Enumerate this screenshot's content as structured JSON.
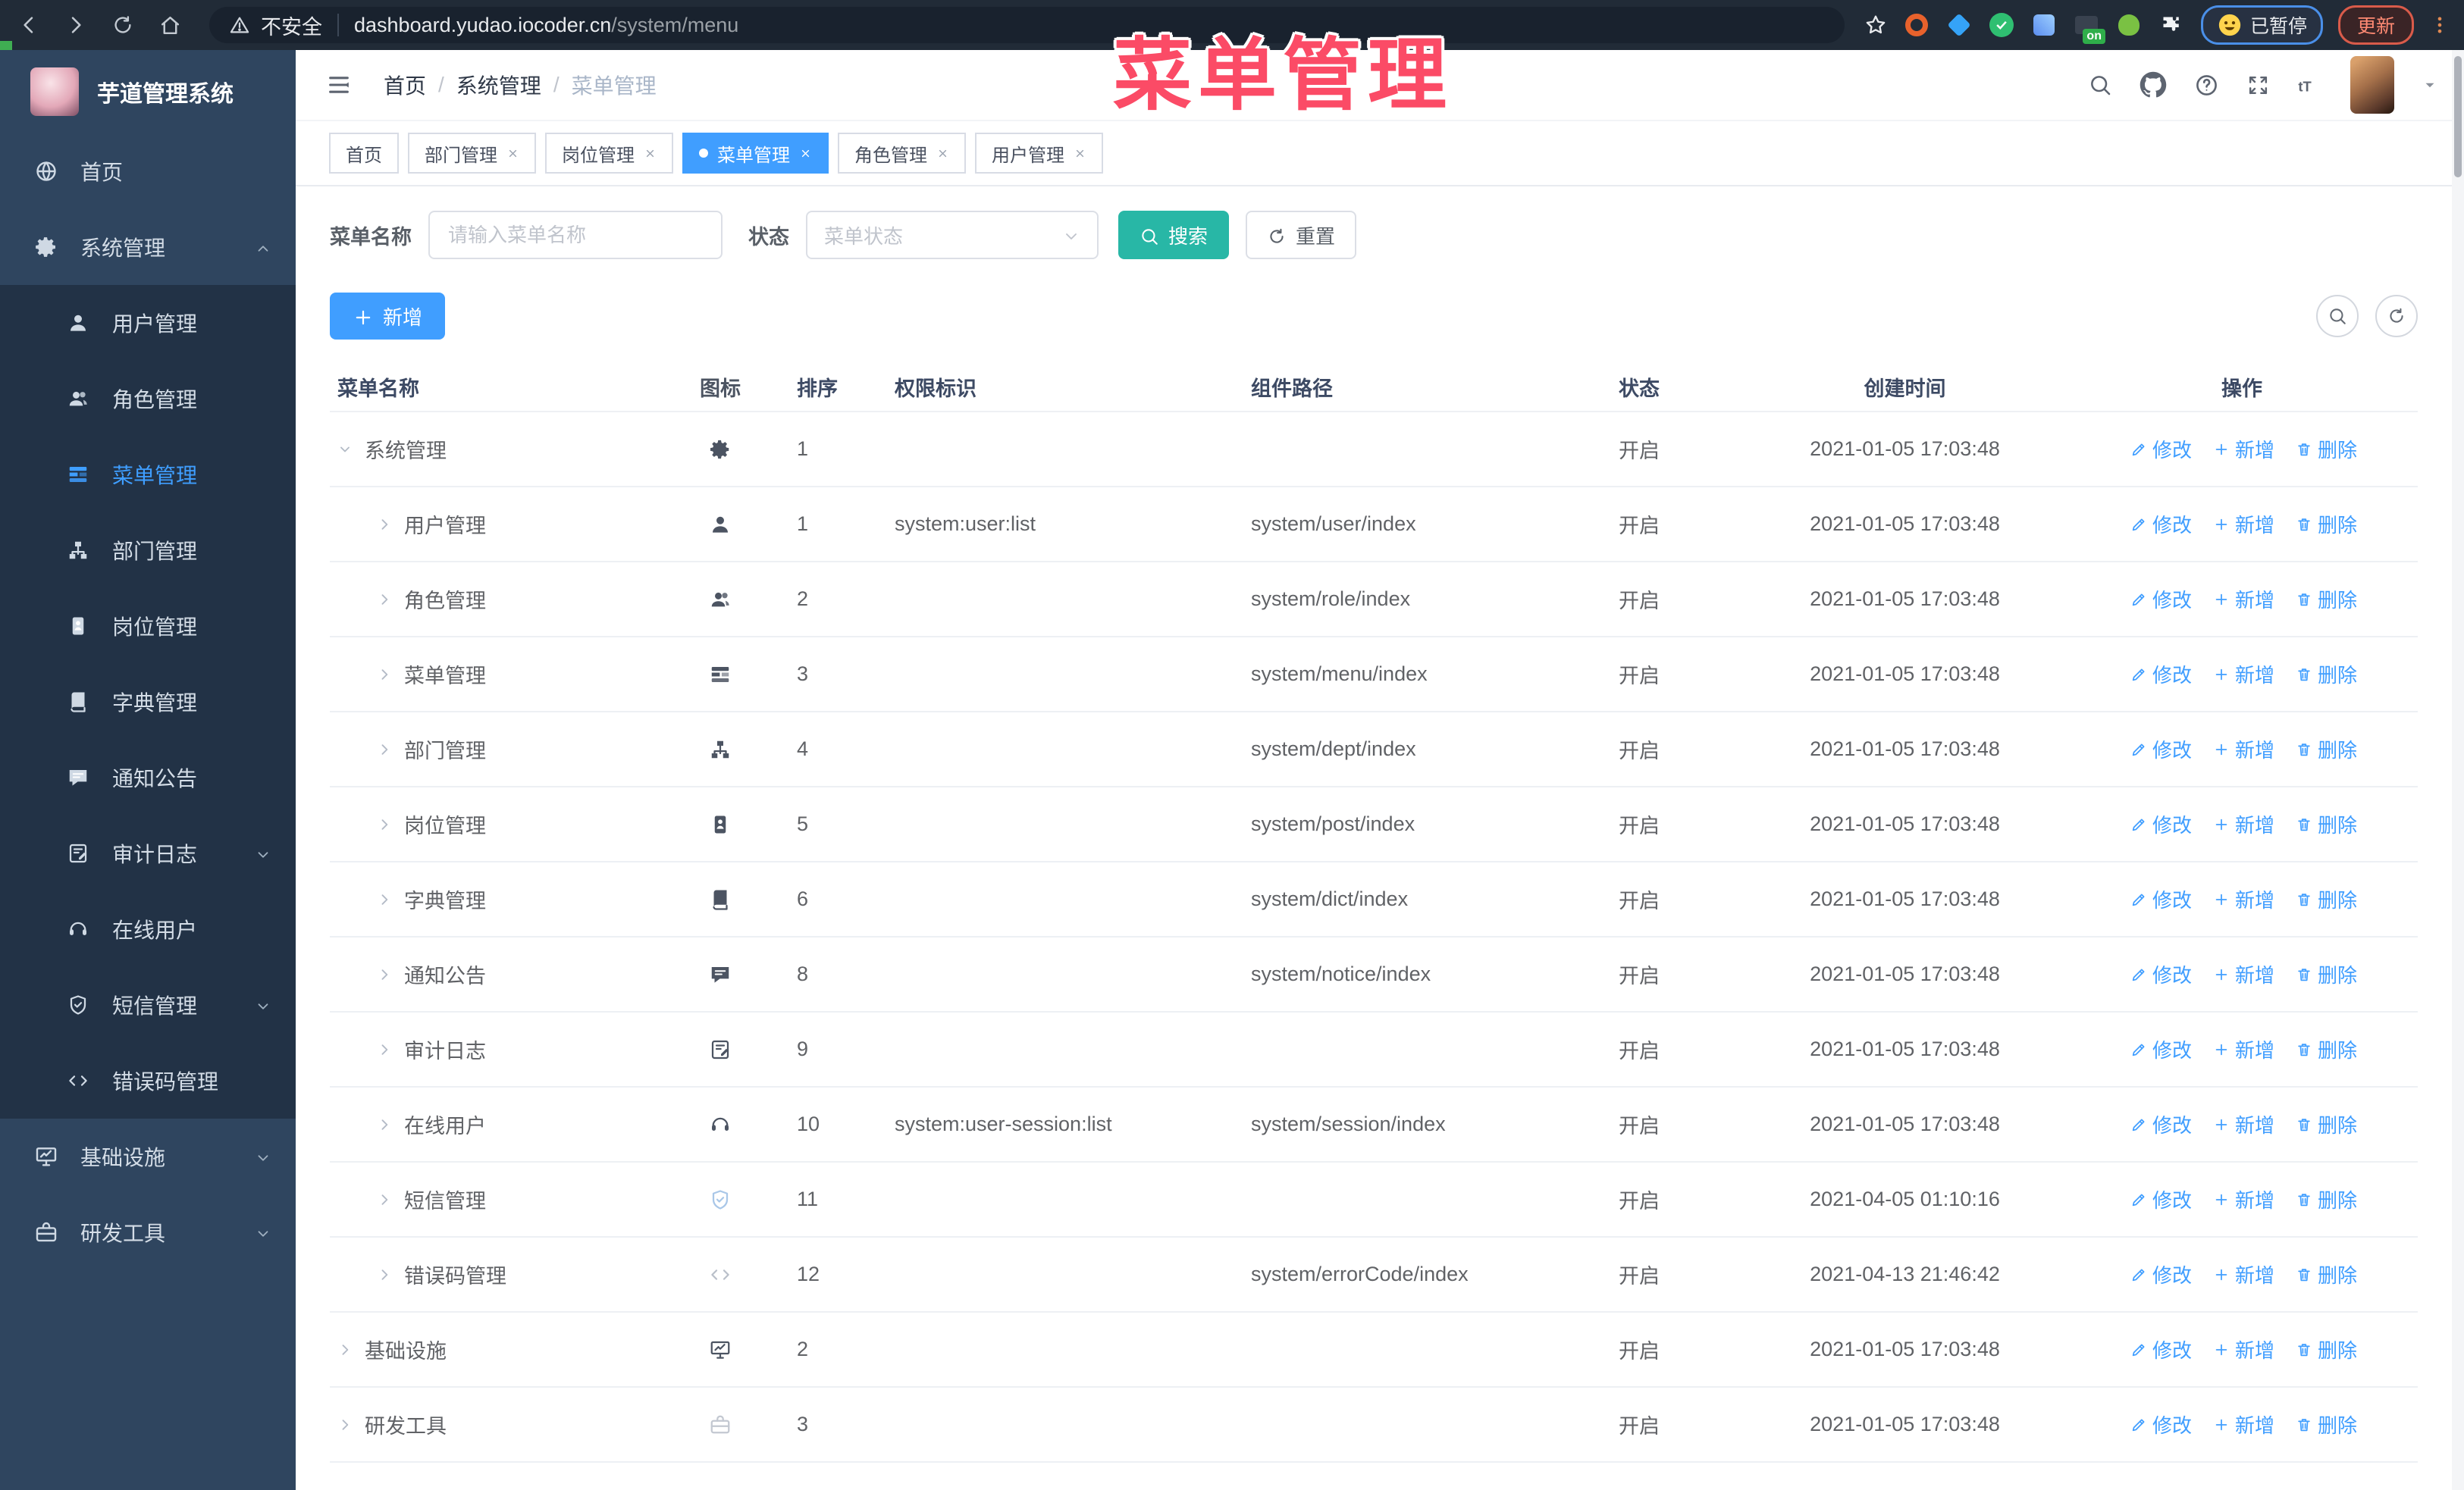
{
  "overlay": {
    "title": "菜单管理"
  },
  "browser": {
    "security_label": "不安全",
    "url_host": "dashboard.yudao.iocoder.cn",
    "url_path": "/system/menu",
    "paused_badge": "已暂停",
    "update_button": "更新",
    "extensions": [
      {
        "glyph": "ring",
        "color": "#e8622c"
      },
      {
        "glyph": "gem",
        "color": "#35a3f7"
      },
      {
        "glyph": "check",
        "color": "#2fbf71"
      },
      {
        "glyph": "grid",
        "color": "#5b8def"
      },
      {
        "glyph": "on",
        "color": "#2b3340"
      },
      {
        "glyph": "frog",
        "color": "#7ac143"
      },
      {
        "glyph": "puzzle",
        "color": "#f2f4f6"
      }
    ]
  },
  "sidebar": {
    "app_title": "芋道管理系统",
    "items": [
      {
        "label": "首页",
        "icon": "globe-icon",
        "level": 0
      },
      {
        "label": "系统管理",
        "icon": "gear-icon",
        "level": 0,
        "chevron": "up"
      },
      {
        "label": "用户管理",
        "icon": "user-icon",
        "level": 1
      },
      {
        "label": "角色管理",
        "icon": "users-icon",
        "level": 1
      },
      {
        "label": "菜单管理",
        "icon": "menu-tree-icon",
        "level": 1,
        "active": true
      },
      {
        "label": "部门管理",
        "icon": "org-icon",
        "level": 1
      },
      {
        "label": "岗位管理",
        "icon": "badge-icon",
        "level": 1
      },
      {
        "label": "字典管理",
        "icon": "dict-icon",
        "level": 1
      },
      {
        "label": "通知公告",
        "icon": "notice-icon",
        "level": 1
      },
      {
        "label": "审计日志",
        "icon": "log-icon",
        "level": 1,
        "chevron": "down"
      },
      {
        "label": "在线用户",
        "icon": "online-icon",
        "level": 1
      },
      {
        "label": "短信管理",
        "icon": "sms-icon",
        "level": 1,
        "chevron": "down"
      },
      {
        "label": "错误码管理",
        "icon": "code-icon",
        "level": 1
      },
      {
        "label": "基础设施",
        "icon": "infra-icon",
        "level": 0,
        "chevron": "down"
      },
      {
        "label": "研发工具",
        "icon": "tools-icon",
        "level": 0,
        "chevron": "down"
      }
    ]
  },
  "header": {
    "breadcrumb": [
      "首页",
      "系统管理",
      "菜单管理"
    ]
  },
  "tabs": [
    {
      "label": "首页",
      "closable": false,
      "active": false
    },
    {
      "label": "部门管理",
      "closable": true,
      "active": false
    },
    {
      "label": "岗位管理",
      "closable": true,
      "active": false
    },
    {
      "label": "菜单管理",
      "closable": true,
      "active": true
    },
    {
      "label": "角色管理",
      "closable": true,
      "active": false
    },
    {
      "label": "用户管理",
      "closable": true,
      "active": false
    }
  ],
  "filters": {
    "name_label": "菜单名称",
    "name_placeholder": "请输入菜单名称",
    "status_label": "状态",
    "status_placeholder": "菜单状态",
    "search_label": "搜索",
    "reset_label": "重置"
  },
  "toolbar": {
    "add_label": "新增"
  },
  "table": {
    "columns": [
      "菜单名称",
      "图标",
      "排序",
      "权限标识",
      "组件路径",
      "状态",
      "创建时间",
      "操作"
    ],
    "actions": {
      "edit": "修改",
      "add": "新增",
      "delete": "删除"
    },
    "rows": [
      {
        "name": "系统管理",
        "icon": "gear-icon",
        "sort": "1",
        "perm": "",
        "path": "",
        "status": "开启",
        "time": "2021-01-05 17:03:48",
        "level": 0,
        "expanded": true
      },
      {
        "name": "用户管理",
        "icon": "user-icon",
        "sort": "1",
        "perm": "system:user:list",
        "path": "system/user/index",
        "status": "开启",
        "time": "2021-01-05 17:03:48",
        "level": 1
      },
      {
        "name": "角色管理",
        "icon": "users-icon",
        "sort": "2",
        "perm": "",
        "path": "system/role/index",
        "status": "开启",
        "time": "2021-01-05 17:03:48",
        "level": 1
      },
      {
        "name": "菜单管理",
        "icon": "menu-tree-icon",
        "sort": "3",
        "perm": "",
        "path": "system/menu/index",
        "status": "开启",
        "time": "2021-01-05 17:03:48",
        "level": 1
      },
      {
        "name": "部门管理",
        "icon": "org-icon",
        "sort": "4",
        "perm": "",
        "path": "system/dept/index",
        "status": "开启",
        "time": "2021-01-05 17:03:48",
        "level": 1
      },
      {
        "name": "岗位管理",
        "icon": "badge-icon",
        "sort": "5",
        "perm": "",
        "path": "system/post/index",
        "status": "开启",
        "time": "2021-01-05 17:03:48",
        "level": 1
      },
      {
        "name": "字典管理",
        "icon": "dict-icon",
        "sort": "6",
        "perm": "",
        "path": "system/dict/index",
        "status": "开启",
        "time": "2021-01-05 17:03:48",
        "level": 1
      },
      {
        "name": "通知公告",
        "icon": "notice-icon",
        "sort": "8",
        "perm": "",
        "path": "system/notice/index",
        "status": "开启",
        "time": "2021-01-05 17:03:48",
        "level": 1
      },
      {
        "name": "审计日志",
        "icon": "log-icon",
        "sort": "9",
        "perm": "",
        "path": "",
        "status": "开启",
        "time": "2021-01-05 17:03:48",
        "level": 1
      },
      {
        "name": "在线用户",
        "icon": "online-icon",
        "sort": "10",
        "perm": "system:user-session:list",
        "path": "system/session/index",
        "status": "开启",
        "time": "2021-01-05 17:03:48",
        "level": 1
      },
      {
        "name": "短信管理",
        "icon": "sms-icon",
        "icon_color": "#a9c7e8",
        "sort": "11",
        "perm": "",
        "path": "",
        "status": "开启",
        "time": "2021-04-05 01:10:16",
        "level": 1
      },
      {
        "name": "错误码管理",
        "icon": "code-icon",
        "icon_color": "#b9bfc9",
        "sort": "12",
        "perm": "",
        "path": "system/errorCode/index",
        "status": "开启",
        "time": "2021-04-13 21:46:42",
        "level": 1
      },
      {
        "name": "基础设施",
        "icon": "infra-icon",
        "sort": "2",
        "perm": "",
        "path": "",
        "status": "开启",
        "time": "2021-01-05 17:03:48",
        "level": 0
      },
      {
        "name": "研发工具",
        "icon": "tools-icon",
        "icon_color": "#c3c8d1",
        "sort": "3",
        "perm": "",
        "path": "",
        "status": "开启",
        "time": "2021-01-05 17:03:48",
        "level": 0
      }
    ]
  },
  "colors": {
    "primary": "#409eff",
    "teal": "#28b7a6",
    "overlay_pink": "#fb4b66",
    "sidebar_bg": "#2f455f",
    "submenu_bg": "#223246",
    "chrome_bg": "#212b37"
  }
}
